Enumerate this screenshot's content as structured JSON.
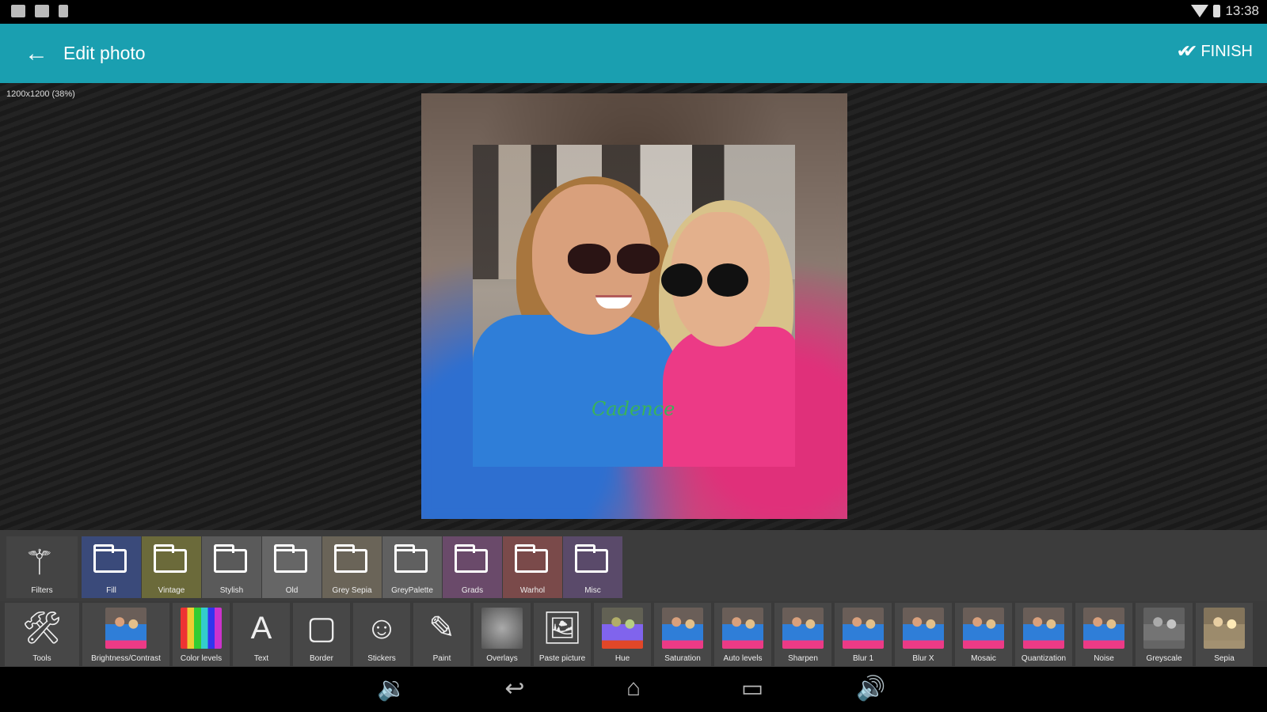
{
  "status_bar": {
    "time": "13:38",
    "left_icons": [
      "image-notification-icon",
      "camera-notification-icon",
      "storage-notification-icon"
    ],
    "right_icons": [
      "wifi-icon",
      "battery-icon"
    ]
  },
  "action_bar": {
    "title": "Edit photo",
    "back_icon": "arrow-left-icon",
    "finish_label": "FINISH",
    "finish_icon": "double-check-icon",
    "color": "#1a9fb0"
  },
  "canvas": {
    "image_info": "1200x1200 (38%)"
  },
  "photo": {
    "shirt_text": "Cadence"
  },
  "filter_folders": [
    {
      "label": "Filters",
      "icon": "magic-wand-icon"
    },
    {
      "label": "Fill",
      "icon": "folder-icon",
      "tint": "#3a4a7a"
    },
    {
      "label": "Vintage",
      "icon": "folder-icon",
      "tint": "#6b6a3a"
    },
    {
      "label": "Stylish",
      "icon": "folder-icon",
      "tint": "#5a5a5a"
    },
    {
      "label": "Old",
      "icon": "folder-icon",
      "tint": "#666666"
    },
    {
      "label": "Grey Sepia",
      "icon": "folder-icon",
      "tint": "#6a6458"
    },
    {
      "label": "GreyPalette",
      "icon": "folder-icon",
      "tint": "#606060"
    },
    {
      "label": "Grads",
      "icon": "folder-icon",
      "tint": "#6a4a6a"
    },
    {
      "label": "Warhol",
      "icon": "folder-icon",
      "tint": "#7a4a4a"
    },
    {
      "label": "Misc",
      "icon": "folder-icon",
      "tint": "#5a4a6a"
    }
  ],
  "tools": [
    {
      "label": "Tools",
      "icon": "wrench-screwdriver-icon",
      "kind": "icon",
      "glyph": "🛠"
    },
    {
      "label": "Brightness/Contrast",
      "icon": "photo-thumb",
      "kind": "thumb",
      "variant": ""
    },
    {
      "label": "Color levels",
      "icon": "photo-thumb",
      "kind": "thumb",
      "variant": "rainbow"
    },
    {
      "label": "Text",
      "icon": "text-icon",
      "kind": "icon",
      "glyph": "A"
    },
    {
      "label": "Border",
      "icon": "border-icon",
      "kind": "icon",
      "glyph": "▢"
    },
    {
      "label": "Stickers",
      "icon": "smiley-icon",
      "kind": "icon",
      "glyph": "☺"
    },
    {
      "label": "Paint",
      "icon": "brush-icon",
      "kind": "icon",
      "glyph": "✎"
    },
    {
      "label": "Overlays",
      "icon": "overlay-thumb",
      "kind": "thumb",
      "variant": "overlay"
    },
    {
      "label": "Paste picture",
      "icon": "paste-picture-icon",
      "kind": "icon",
      "glyph": "🖼"
    },
    {
      "label": "Hue",
      "icon": "photo-thumb",
      "kind": "thumb",
      "variant": "hue"
    },
    {
      "label": "Saturation",
      "icon": "photo-thumb",
      "kind": "thumb",
      "variant": ""
    },
    {
      "label": "Auto levels",
      "icon": "photo-thumb",
      "kind": "thumb",
      "variant": ""
    },
    {
      "label": "Sharpen",
      "icon": "photo-thumb",
      "kind": "thumb",
      "variant": ""
    },
    {
      "label": "Blur 1",
      "icon": "photo-thumb",
      "kind": "thumb",
      "variant": ""
    },
    {
      "label": "Blur X",
      "icon": "photo-thumb",
      "kind": "thumb",
      "variant": ""
    },
    {
      "label": "Mosaic",
      "icon": "photo-thumb",
      "kind": "thumb",
      "variant": ""
    },
    {
      "label": "Quantization",
      "icon": "photo-thumb",
      "kind": "thumb",
      "variant": ""
    },
    {
      "label": "Noise",
      "icon": "photo-thumb",
      "kind": "thumb",
      "variant": ""
    },
    {
      "label": "Greyscale",
      "icon": "photo-thumb",
      "kind": "thumb",
      "variant": "grey"
    },
    {
      "label": "Sepia",
      "icon": "photo-thumb",
      "kind": "thumb",
      "variant": "sepia"
    }
  ],
  "nav_bar": [
    {
      "icon": "volume-down-icon",
      "glyph": "🔉"
    },
    {
      "icon": "back-nav-icon",
      "glyph": "↩"
    },
    {
      "icon": "home-nav-icon",
      "glyph": "⌂"
    },
    {
      "icon": "recents-nav-icon",
      "glyph": "▭"
    },
    {
      "icon": "volume-up-icon",
      "glyph": "🔊"
    }
  ]
}
